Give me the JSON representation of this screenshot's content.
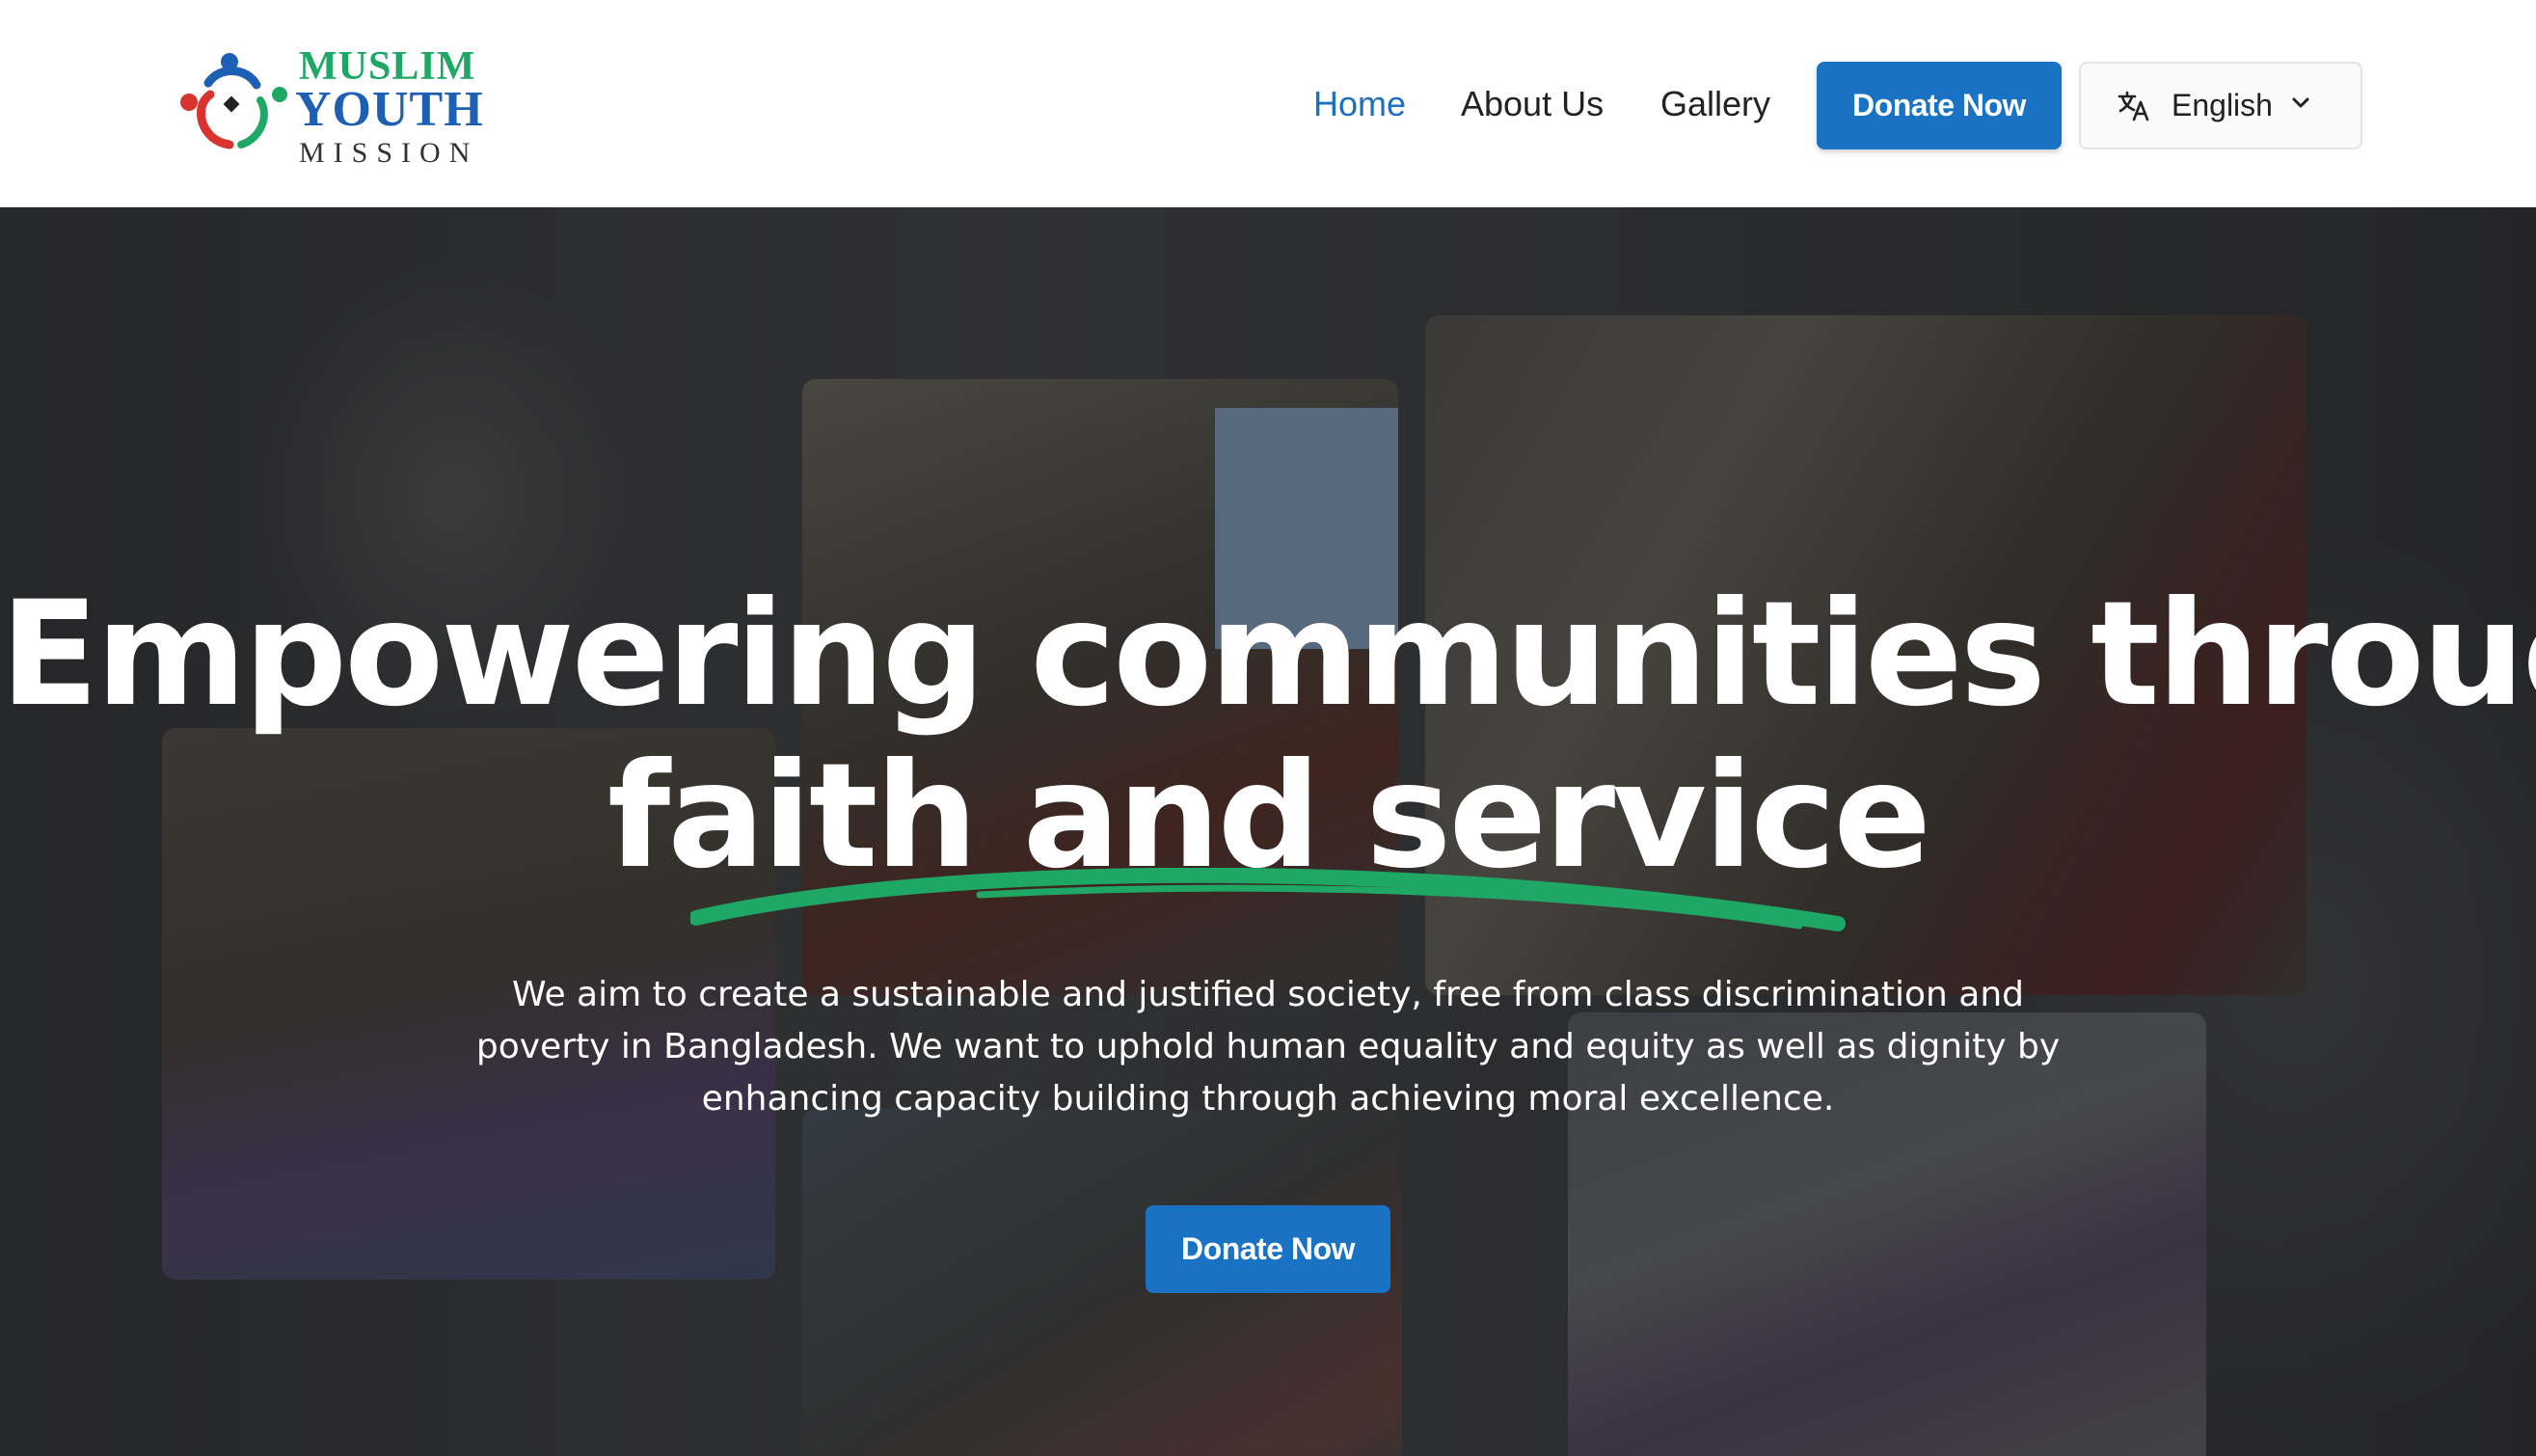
{
  "brand": {
    "line1": "MUSLIM",
    "line2": "YOUTH",
    "line3": "MISSION",
    "colors": {
      "green": "#1fa865",
      "blue": "#1d5fb5",
      "red": "#d8332f"
    }
  },
  "nav": {
    "items": [
      {
        "label": "Home",
        "active": true
      },
      {
        "label": "About Us",
        "active": false
      },
      {
        "label": "Gallery",
        "active": false
      }
    ],
    "donate_label": "Donate Now",
    "language": {
      "icon": "translate-icon",
      "selected": "English"
    }
  },
  "hero": {
    "title_line1": "Empowering communities through",
    "title_line2": "faith and service",
    "description": "We aim to create a sustainable and justified society, free from class discrimination and poverty in Bangladesh. We want to uphold human equality and equity as well as dignity by enhancing capacity building through achieving moral excellence.",
    "donate_label": "Donate Now",
    "accent_color": "#1fa865",
    "button_color": "#1a72c4"
  }
}
